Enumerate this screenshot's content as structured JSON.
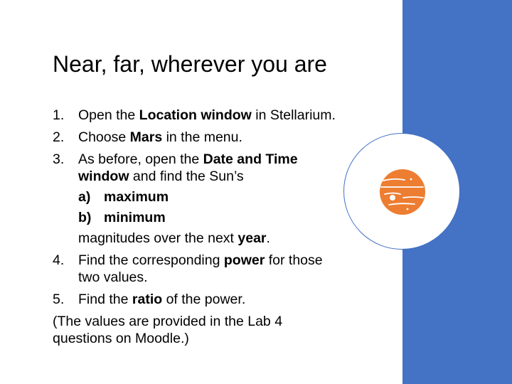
{
  "slide": {
    "title": "Near, far, wherever you are",
    "steps": [
      {
        "num": "1.",
        "parts": [
          {
            "t": "Open the ",
            "b": false
          },
          {
            "t": "Location window",
            "b": true
          },
          {
            "t": " in Stellarium.",
            "b": false
          }
        ]
      },
      {
        "num": "2.",
        "parts": [
          {
            "t": "Choose ",
            "b": false
          },
          {
            "t": "Mars",
            "b": true
          },
          {
            "t": " in the menu.",
            "b": false
          }
        ]
      },
      {
        "num": "3.",
        "parts": [
          {
            "t": "As before, open the ",
            "b": false
          },
          {
            "t": "Date and Time window",
            "b": true
          },
          {
            "t": " and find the Sun’s",
            "b": false
          }
        ],
        "subitems": [
          {
            "letter": "a)",
            "text": "maximum"
          },
          {
            "letter": "b)",
            "text": "minimum"
          }
        ],
        "after": [
          {
            "t": "magnitudes over the next ",
            "b": false
          },
          {
            "t": "year",
            "b": true
          },
          {
            "t": ".",
            "b": false
          }
        ]
      },
      {
        "num": "4.",
        "parts": [
          {
            "t": "Find the corresponding ",
            "b": false
          },
          {
            "t": "power",
            "b": true
          },
          {
            "t": " for those two values.",
            "b": false
          }
        ]
      },
      {
        "num": "5.",
        "parts": [
          {
            "t": "Find the ",
            "b": false
          },
          {
            "t": "ratio",
            "b": true
          },
          {
            "t": " of the power.",
            "b": false
          }
        ]
      }
    ],
    "note": "(The values are provided in the Lab 4 questions on Moodle.)"
  },
  "decor": {
    "panel_color": "#4472C4",
    "planet_icon": "jupiter-planet-icon",
    "planet_color": "#ED7D31"
  }
}
